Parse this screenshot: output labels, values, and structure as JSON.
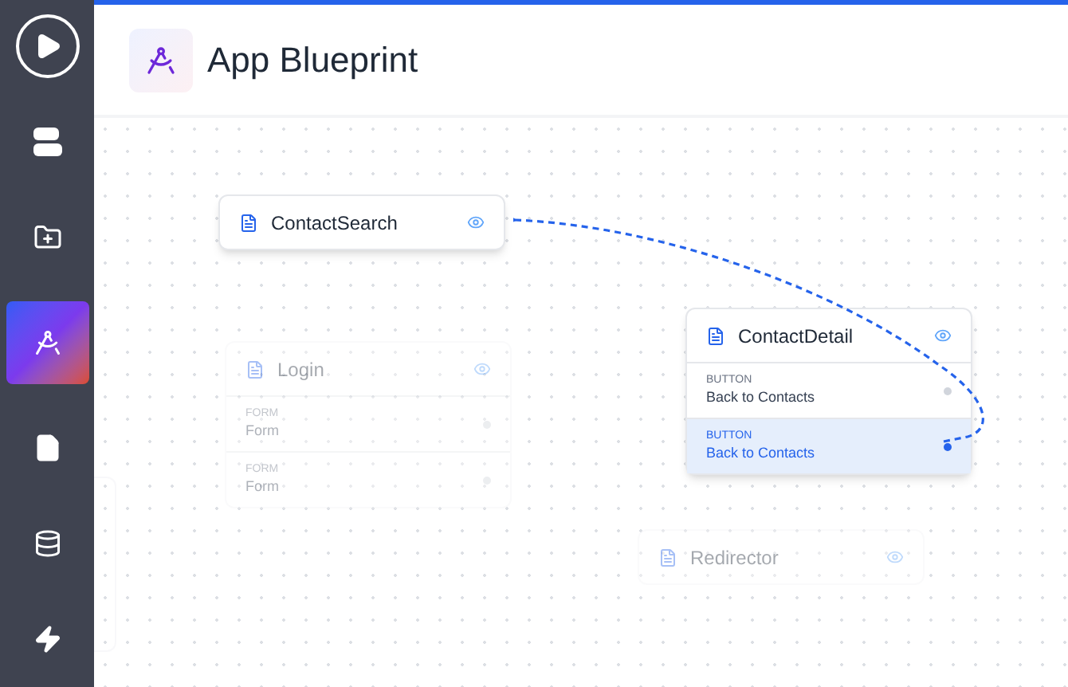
{
  "sidebar": {
    "items": [
      {
        "kind": "play",
        "selected": false
      },
      {
        "kind": "stack",
        "selected": false
      },
      {
        "kind": "folder",
        "selected": false
      },
      {
        "kind": "blueprint",
        "selected": true
      },
      {
        "kind": "file",
        "selected": false
      },
      {
        "kind": "database",
        "selected": false
      },
      {
        "kind": "bolt",
        "selected": false
      }
    ]
  },
  "header": {
    "title": "App Blueprint"
  },
  "nodes": [
    {
      "title": "ContactSearch",
      "faded": false
    },
    {
      "title": "Login",
      "faded": true,
      "items": [
        {
          "type": "FORM",
          "label": "Form",
          "selected": false
        },
        {
          "type": "FORM",
          "label": "Form",
          "selected": false
        }
      ]
    },
    {
      "title": "ContactDetail",
      "faded": false,
      "items": [
        {
          "type": "BUTTON",
          "label": "Back to Contacts",
          "selected": false
        },
        {
          "type": "BUTTON",
          "label": "Back to Contacts",
          "selected": true
        }
      ]
    },
    {
      "title": "Redirector",
      "faded": true
    }
  ]
}
